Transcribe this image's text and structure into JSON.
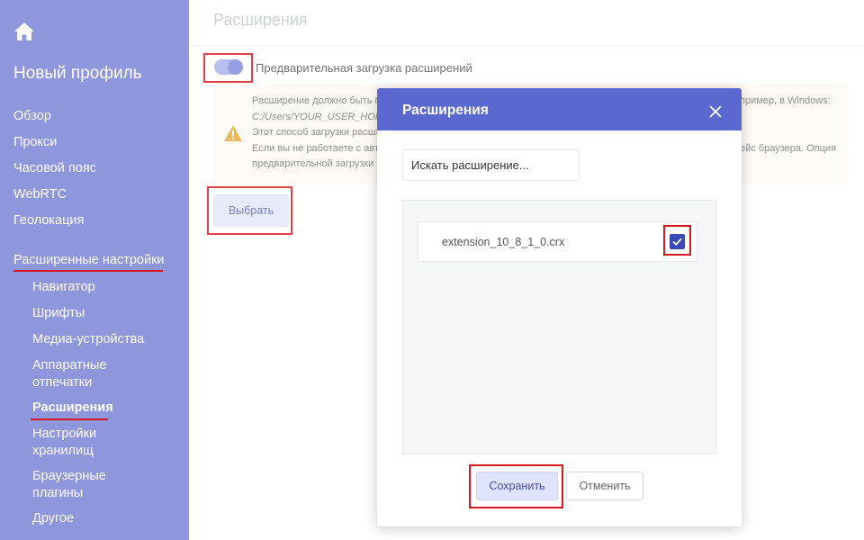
{
  "sidebar": {
    "home_icon": "home-icon",
    "profile_title": "Новый профиль",
    "nav": [
      "Обзор",
      "Прокси",
      "Часовой пояс",
      "WebRTC",
      "Геолокация"
    ],
    "advanced_label": "Расширенные настройки",
    "sub_items": [
      {
        "label": "Навигатор",
        "active": false
      },
      {
        "label": "Шрифты",
        "active": false
      },
      {
        "label": "Медиа-устройства",
        "active": false
      },
      {
        "label": "Аппаратные отпечатки",
        "active": false
      },
      {
        "label": "Расширения",
        "active": true
      },
      {
        "label": "Настройки хранилищ",
        "active": false
      },
      {
        "label": "Браузерные плагины",
        "active": false
      },
      {
        "label": "Другое",
        "active": false
      }
    ]
  },
  "main": {
    "page_title": "Расширения",
    "toggle": {
      "label": "Предварительная загрузка расширений",
      "on": true
    },
    "warning": {
      "icon": "warning-icon",
      "line1": "Расширение должно быть п",
      "line1_end": "пример, в Windows:",
      "path": "C:/Users/YOUR_USER_HOME_",
      "line3": "Этот способ загрузки расши",
      "line4": "Если вы не работаете с авто",
      "line4_end": "ейс браузера. Опция",
      "line5": "предварительной загрузки р"
    },
    "select_button": "Выбрать"
  },
  "modal": {
    "title": "Расширения",
    "close_icon": "close-icon",
    "search_placeholder": "Искать расширение...",
    "extensions": [
      {
        "name": "extension_10_8_1_0.crx",
        "checked": true
      }
    ],
    "save_button": "Сохранить",
    "cancel_button": "Отменить"
  },
  "colors": {
    "sidebar": "#8f97dc",
    "modal_header": "#5a68d0",
    "highlight": "#d7191f",
    "checkbox": "#3b4bb5"
  }
}
